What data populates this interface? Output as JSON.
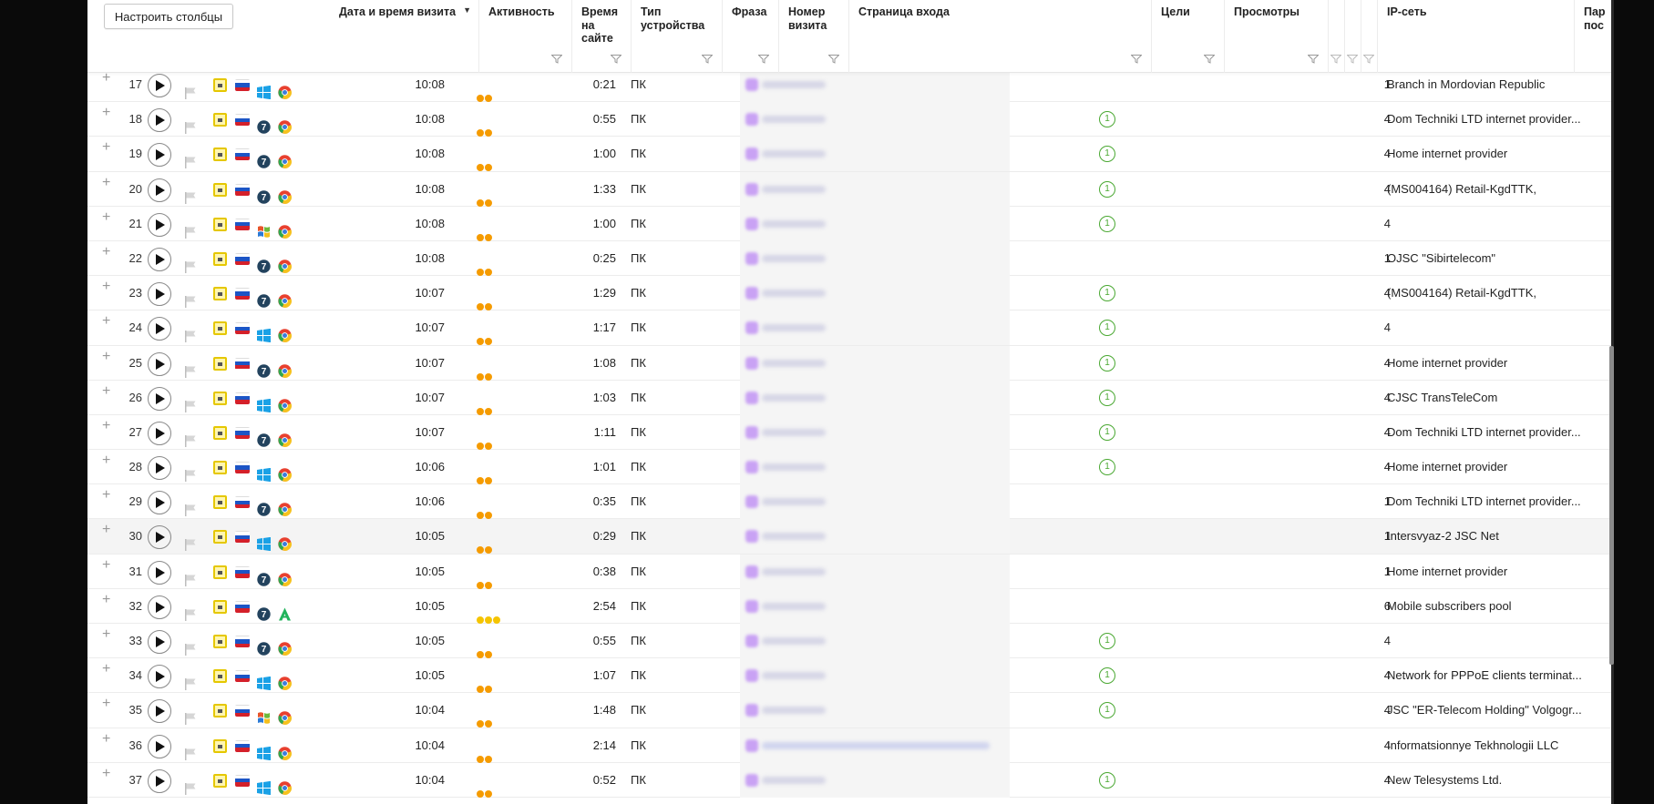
{
  "toolbar": {
    "configure_columns": "Настроить столбцы"
  },
  "columns": {
    "datetime": "Дата и время визита",
    "activity": "Активность",
    "time_on_site": "Время на сайте",
    "device_type": "Тип устройства",
    "phrase": "Фраза",
    "visit_number": "Номер визита",
    "entry_page": "Страница входа",
    "goals": "Цели",
    "views": "Просмотры",
    "ip_network": "IP-сеть",
    "params": "Пар пос"
  },
  "sort_indicator": "▼",
  "colors": {
    "activity_dot": "#f59b00",
    "activity_dot_alt": "#f5c400",
    "goal": "#4aa832",
    "blur_accent": "#c9a2f4"
  },
  "rows": [
    {
      "n": "17",
      "os": "windows-icon",
      "br": "chrome-icon",
      "time": "10:08",
      "dots": 2,
      "dot_color": "orange",
      "dur": "0:21",
      "dev": "ПК",
      "visit": "1",
      "goal": "",
      "views": "1",
      "ip": "Branch in Mordovian Republic"
    },
    {
      "n": "18",
      "os": "win7-icon",
      "br": "chrome-icon",
      "time": "10:08",
      "dots": 2,
      "dot_color": "orange",
      "dur": "0:55",
      "dev": "ПК",
      "visit": "1",
      "goal": "1",
      "views": "4",
      "ip": "Dom Techniki LTD internet provider..."
    },
    {
      "n": "19",
      "os": "win7-icon",
      "br": "chrome-icon",
      "time": "10:08",
      "dots": 2,
      "dot_color": "orange",
      "dur": "1:00",
      "dev": "ПК",
      "visit": "1",
      "goal": "1",
      "views": "4",
      "ip": "Home internet provider"
    },
    {
      "n": "20",
      "os": "win7-icon",
      "br": "chrome-icon",
      "time": "10:08",
      "dots": 2,
      "dot_color": "orange",
      "dur": "1:33",
      "dev": "ПК",
      "visit": "1",
      "goal": "1",
      "views": "4",
      "ip": "(MS004164) Retail-KgdTTK,"
    },
    {
      "n": "21",
      "os": "winxp-icon",
      "br": "chrome-icon",
      "time": "10:08",
      "dots": 2,
      "dot_color": "orange",
      "dur": "1:00",
      "dev": "ПК",
      "visit": "1",
      "goal": "1",
      "views": "4",
      "ip": ""
    },
    {
      "n": "22",
      "os": "win7-icon",
      "br": "chrome-icon",
      "time": "10:08",
      "dots": 2,
      "dot_color": "orange",
      "dur": "0:25",
      "dev": "ПК",
      "visit": "1",
      "goal": "",
      "views": "1",
      "ip": "OJSC \"Sibirtelecom\""
    },
    {
      "n": "23",
      "os": "win7-icon",
      "br": "chrome-icon",
      "time": "10:07",
      "dots": 2,
      "dot_color": "orange",
      "dur": "1:29",
      "dev": "ПК",
      "visit": "1",
      "goal": "1",
      "views": "4",
      "ip": "(MS004164) Retail-KgdTTK,"
    },
    {
      "n": "24",
      "os": "windows-icon",
      "br": "chrome-icon",
      "time": "10:07",
      "dots": 2,
      "dot_color": "orange",
      "dur": "1:17",
      "dev": "ПК",
      "visit": "1",
      "goal": "1",
      "views": "4",
      "ip": ""
    },
    {
      "n": "25",
      "os": "win7-icon",
      "br": "chrome-icon",
      "time": "10:07",
      "dots": 2,
      "dot_color": "orange",
      "dur": "1:08",
      "dev": "ПК",
      "visit": "1",
      "goal": "1",
      "views": "4",
      "ip": "Home internet provider"
    },
    {
      "n": "26",
      "os": "windows-icon",
      "br": "chrome-icon",
      "time": "10:07",
      "dots": 2,
      "dot_color": "orange",
      "dur": "1:03",
      "dev": "ПК",
      "visit": "2",
      "goal": "1",
      "views": "4",
      "ip": "CJSC TransTeleCom"
    },
    {
      "n": "27",
      "os": "win7-icon",
      "br": "chrome-icon",
      "time": "10:07",
      "dots": 2,
      "dot_color": "orange",
      "dur": "1:11",
      "dev": "ПК",
      "visit": "1",
      "goal": "1",
      "views": "4",
      "ip": "Dom Techniki LTD internet provider..."
    },
    {
      "n": "28",
      "os": "windows-icon",
      "br": "chrome-icon",
      "time": "10:06",
      "dots": 2,
      "dot_color": "orange",
      "dur": "1:01",
      "dev": "ПК",
      "visit": "1",
      "goal": "1",
      "views": "4",
      "ip": "Home internet provider"
    },
    {
      "n": "29",
      "os": "win7-icon",
      "br": "chrome-icon",
      "time": "10:06",
      "dots": 2,
      "dot_color": "orange",
      "dur": "0:35",
      "dev": "ПК",
      "visit": "3",
      "goal": "",
      "views": "1",
      "ip": "Dom Techniki LTD internet provider..."
    },
    {
      "n": "30",
      "os": "windows-icon",
      "br": "chrome-icon",
      "time": "10:05",
      "dots": 2,
      "dot_color": "orange",
      "dur": "0:29",
      "dev": "ПК",
      "visit": "1",
      "goal": "",
      "views": "1",
      "ip": "Intersvyaz-2 JSC Net",
      "highlight": true
    },
    {
      "n": "31",
      "os": "win7-icon",
      "br": "chrome-icon",
      "time": "10:05",
      "dots": 2,
      "dot_color": "orange",
      "dur": "0:38",
      "dev": "ПК",
      "visit": "1",
      "goal": "",
      "views": "1",
      "ip": "Home internet provider"
    },
    {
      "n": "32",
      "os": "win7-icon",
      "br": "a-browser-icon",
      "time": "10:05",
      "dots": 3,
      "dot_color": "yellow",
      "dur": "2:54",
      "dev": "ПК",
      "visit": "1",
      "goal": "",
      "views": "6",
      "ip": "Mobile subscribers pool"
    },
    {
      "n": "33",
      "os": "win7-icon",
      "br": "chrome-icon",
      "time": "10:05",
      "dots": 2,
      "dot_color": "orange",
      "dur": "0:55",
      "dev": "ПК",
      "visit": "1",
      "goal": "1",
      "views": "4",
      "ip": ""
    },
    {
      "n": "34",
      "os": "windows-icon",
      "br": "chrome-icon",
      "time": "10:05",
      "dots": 2,
      "dot_color": "orange",
      "dur": "1:07",
      "dev": "ПК",
      "visit": "1",
      "goal": "1",
      "views": "4",
      "ip": "Network for PPPoE clients terminat..."
    },
    {
      "n": "35",
      "os": "winxp-icon",
      "br": "chrome-icon",
      "time": "10:04",
      "dots": 2,
      "dot_color": "orange",
      "dur": "1:48",
      "dev": "ПК",
      "visit": "1",
      "goal": "1",
      "views": "4",
      "ip": "JSC \"ER-Telecom Holding\" Volgogr..."
    },
    {
      "n": "36",
      "os": "windows-icon",
      "br": "chrome-icon",
      "time": "10:04",
      "dots": 2,
      "dot_color": "orange",
      "dur": "2:14",
      "dev": "ПК",
      "visit": "2",
      "goal": "",
      "views": "4",
      "ip": "Informatsionnye Tekhnologii LLC",
      "long_url": true
    },
    {
      "n": "37",
      "os": "windows-icon",
      "br": "chrome-icon",
      "time": "10:04",
      "dots": 2,
      "dot_color": "orange",
      "dur": "0:52",
      "dev": "ПК",
      "visit": "1",
      "goal": "1",
      "views": "4",
      "ip": "New Telesystems Ltd."
    }
  ]
}
